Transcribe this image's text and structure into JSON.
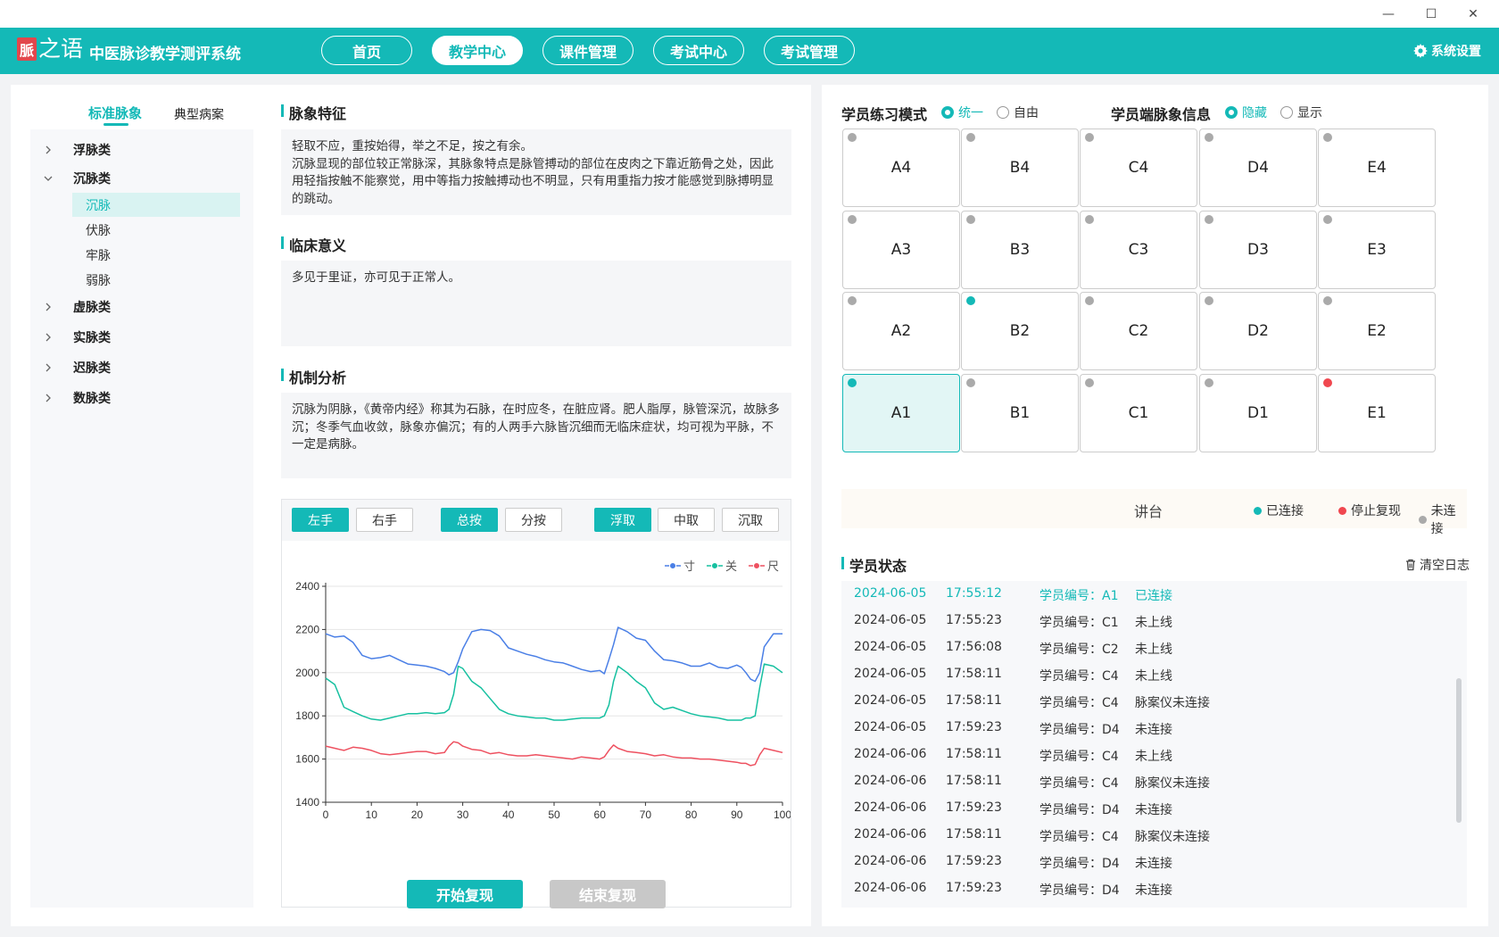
{
  "window": {
    "minimize": "—",
    "maximize": "☐",
    "close": "✕"
  },
  "header": {
    "logo_mark": "脈",
    "logo_word": "之语",
    "app_title": "中医脉诊教学测评系统",
    "nav": [
      "首页",
      "教学中心",
      "课件管理",
      "考试中心",
      "考试管理"
    ],
    "active_nav": "教学中心",
    "settings_label": "系统设置"
  },
  "sidebar": {
    "tabs": [
      "标准脉象",
      "典型病案"
    ],
    "active_tab": "标准脉象",
    "groups": [
      "浮脉类",
      "沉脉类",
      "虚脉类",
      "实脉类",
      "迟脉类",
      "数脉类"
    ],
    "expanded_group": "沉脉类",
    "children": [
      "沉脉",
      "伏脉",
      "牢脉",
      "弱脉"
    ],
    "selected_child": "沉脉"
  },
  "content": {
    "features_title": "脉象特征",
    "features_text": "轻取不应，重按始得，举之不足，按之有余。\n沉脉显现的部位较正常脉深，其脉象特点是脉管搏动的部位在皮肉之下靠近筋骨之处，因此用轻指按触不能察觉，用中等指力按触搏动也不明显，只有用重指力按才能感觉到脉搏明显的跳动。",
    "clinical_title": "临床意义",
    "clinical_text": "多见于里证，亦可见于正常人。",
    "mechanism_title": "机制分析",
    "mechanism_text": "沉脉为阴脉，《黄帝内经》称其为石脉，在时应冬，在脏应肾。肥人脂厚，脉管深沉，故脉多沉；冬季气血收敛，脉象亦偏沉；有的人两手六脉皆沉细而无临床症状，均可视为平脉，不一定是病脉。"
  },
  "chart_controls": {
    "hand": [
      "左手",
      "右手"
    ],
    "hand_active": "左手",
    "press_mode": [
      "总按",
      "分按"
    ],
    "press_mode_active": "总按",
    "depth": [
      "浮取",
      "中取",
      "沉取"
    ],
    "depth_active": "浮取",
    "start_label": "开始复现",
    "stop_label": "结束复现"
  },
  "chart_data": {
    "type": "line",
    "x_ticks": [
      0,
      10,
      20,
      30,
      40,
      50,
      60,
      70,
      80,
      90,
      100
    ],
    "y_ticks": [
      1400,
      1600,
      1800,
      2000,
      2200,
      2400
    ],
    "xlim": [
      0,
      100
    ],
    "ylim": [
      1400,
      2400
    ],
    "legend_position": "top-right",
    "grid": "horizontal",
    "series": [
      {
        "name": "寸",
        "color": "#4a7fe6",
        "x": [
          0,
          2,
          4,
          6,
          8,
          10,
          12,
          14,
          16,
          18,
          20,
          22,
          24,
          26,
          27,
          28,
          29,
          30,
          32,
          34,
          36,
          38,
          40,
          42,
          44,
          46,
          48,
          50,
          52,
          54,
          56,
          58,
          60,
          61,
          62,
          63,
          64,
          66,
          68,
          70,
          72,
          74,
          76,
          78,
          80,
          82,
          84,
          86,
          88,
          90,
          91,
          92,
          93,
          94,
          95,
          96,
          98,
          100
        ],
        "y": [
          2180,
          2165,
          2170,
          2140,
          2080,
          2065,
          2070,
          2080,
          2060,
          2040,
          2035,
          2030,
          2020,
          2005,
          1990,
          2000,
          2050,
          2110,
          2190,
          2200,
          2195,
          2170,
          2115,
          2100,
          2085,
          2075,
          2060,
          2050,
          2045,
          2030,
          2015,
          2005,
          2010,
          1995,
          2060,
          2130,
          2210,
          2190,
          2160,
          2150,
          2100,
          2060,
          2055,
          2045,
          2030,
          2030,
          2045,
          2025,
          2020,
          2035,
          2025,
          2000,
          1970,
          1960,
          2000,
          2120,
          2180,
          2180
        ]
      },
      {
        "name": "关",
        "color": "#16c0a0",
        "x": [
          0,
          2,
          4,
          6,
          8,
          10,
          12,
          14,
          16,
          18,
          20,
          22,
          24,
          26,
          27,
          28,
          29,
          30,
          32,
          34,
          36,
          38,
          40,
          42,
          44,
          46,
          48,
          50,
          52,
          54,
          56,
          58,
          60,
          61,
          62,
          63,
          64,
          66,
          68,
          70,
          72,
          74,
          76,
          78,
          80,
          82,
          84,
          86,
          88,
          90,
          91,
          92,
          93,
          94,
          95,
          96,
          98,
          100
        ],
        "y": [
          1975,
          1945,
          1840,
          1820,
          1800,
          1785,
          1780,
          1790,
          1800,
          1810,
          1810,
          1815,
          1810,
          1815,
          1830,
          1900,
          2030,
          2020,
          1960,
          1930,
          1880,
          1830,
          1810,
          1800,
          1795,
          1790,
          1790,
          1780,
          1780,
          1785,
          1790,
          1790,
          1790,
          1800,
          1850,
          1960,
          2030,
          2000,
          1960,
          1930,
          1860,
          1830,
          1840,
          1825,
          1810,
          1800,
          1795,
          1790,
          1780,
          1780,
          1780,
          1790,
          1790,
          1800,
          1930,
          2040,
          2030,
          2000
        ]
      },
      {
        "name": "尺",
        "color": "#ee5160",
        "x": [
          0,
          2,
          4,
          6,
          8,
          10,
          12,
          14,
          16,
          18,
          20,
          22,
          24,
          26,
          27,
          28,
          29,
          30,
          32,
          34,
          36,
          38,
          40,
          42,
          44,
          46,
          48,
          50,
          52,
          54,
          56,
          58,
          60,
          61,
          62,
          63,
          64,
          66,
          68,
          70,
          72,
          74,
          76,
          78,
          80,
          82,
          84,
          86,
          88,
          90,
          91,
          92,
          93,
          94,
          95,
          96,
          98,
          100
        ],
        "y": [
          1660,
          1650,
          1640,
          1655,
          1650,
          1640,
          1625,
          1620,
          1625,
          1630,
          1635,
          1635,
          1625,
          1630,
          1660,
          1680,
          1675,
          1660,
          1645,
          1640,
          1625,
          1630,
          1620,
          1615,
          1615,
          1620,
          1615,
          1610,
          1605,
          1600,
          1610,
          1605,
          1600,
          1610,
          1640,
          1665,
          1650,
          1635,
          1630,
          1625,
          1615,
          1620,
          1610,
          1605,
          1605,
          1600,
          1600,
          1595,
          1590,
          1585,
          1580,
          1580,
          1570,
          1575,
          1620,
          1650,
          1640,
          1630
        ]
      }
    ]
  },
  "practice": {
    "mode_label": "学员练习模式",
    "mode_options": [
      "统一",
      "自由"
    ],
    "mode_selected": "统一",
    "info_label": "学员端脉象信息",
    "info_options": [
      "隐藏",
      "显示"
    ],
    "info_selected": "隐藏"
  },
  "seats": {
    "rows": [
      [
        {
          "id": "A4",
          "status": "gray"
        },
        {
          "id": "B4",
          "status": "gray"
        },
        {
          "id": "C4",
          "status": "gray"
        },
        {
          "id": "D4",
          "status": "gray"
        },
        {
          "id": "E4",
          "status": "gray"
        }
      ],
      [
        {
          "id": "A3",
          "status": "gray"
        },
        {
          "id": "B3",
          "status": "gray"
        },
        {
          "id": "C3",
          "status": "gray"
        },
        {
          "id": "D3",
          "status": "gray"
        },
        {
          "id": "E3",
          "status": "gray"
        }
      ],
      [
        {
          "id": "A2",
          "status": "gray"
        },
        {
          "id": "B2",
          "status": "green"
        },
        {
          "id": "C2",
          "status": "gray"
        },
        {
          "id": "D2",
          "status": "gray"
        },
        {
          "id": "E2",
          "status": "gray"
        }
      ],
      [
        {
          "id": "A1",
          "status": "green"
        },
        {
          "id": "B1",
          "status": "gray"
        },
        {
          "id": "C1",
          "status": "gray"
        },
        {
          "id": "D1",
          "status": "gray"
        },
        {
          "id": "E1",
          "status": "red"
        }
      ]
    ],
    "selected": "A1",
    "status_colors": {
      "green": "#14b9b7",
      "red": "#f0474f",
      "gray": "#aaaaaa"
    }
  },
  "podium": {
    "label": "讲台",
    "legend": [
      {
        "label": "已连接",
        "color": "#14b9b7"
      },
      {
        "label": "停止复现",
        "color": "#f0474f"
      },
      {
        "label": "未连接",
        "color": "#aaaaaa"
      }
    ]
  },
  "student_status": {
    "title": "学员状态",
    "clear_label": "清空日志",
    "log": [
      {
        "date": "2024-06-05",
        "time": "17:55:12",
        "student": "学员编号：A1",
        "status": "已连接",
        "highlight": true
      },
      {
        "date": "2024-06-05",
        "time": "17:55:23",
        "student": "学员编号：C1",
        "status": "未上线"
      },
      {
        "date": "2024-06-05",
        "time": "17:56:08",
        "student": "学员编号：C2",
        "status": "未上线"
      },
      {
        "date": "2024-06-05",
        "time": "17:58:11",
        "student": "学员编号：C4",
        "status": "未上线"
      },
      {
        "date": "2024-06-05",
        "time": "17:58:11",
        "student": "学员编号：C4",
        "status": "脉案仪未连接"
      },
      {
        "date": "2024-06-05",
        "time": "17:59:23",
        "student": "学员编号：D4",
        "status": "未连接"
      },
      {
        "date": "2024-06-06",
        "time": "17:58:11",
        "student": "学员编号：C4",
        "status": "未上线"
      },
      {
        "date": "2024-06-06",
        "time": "17:58:11",
        "student": "学员编号：C4",
        "status": "脉案仪未连接"
      },
      {
        "date": "2024-06-06",
        "time": "17:59:23",
        "student": "学员编号：D4",
        "status": "未连接"
      },
      {
        "date": "2024-06-06",
        "time": "17:58:11",
        "student": "学员编号：C4",
        "status": "脉案仪未连接"
      },
      {
        "date": "2024-06-06",
        "time": "17:59:23",
        "student": "学员编号：D4",
        "status": "未连接"
      },
      {
        "date": "2024-06-06",
        "time": "17:59:23",
        "student": "学员编号：D4",
        "status": "未连接"
      }
    ]
  },
  "colors": {
    "accent": "#14b9b7",
    "disabled": "#c8c8c8"
  }
}
